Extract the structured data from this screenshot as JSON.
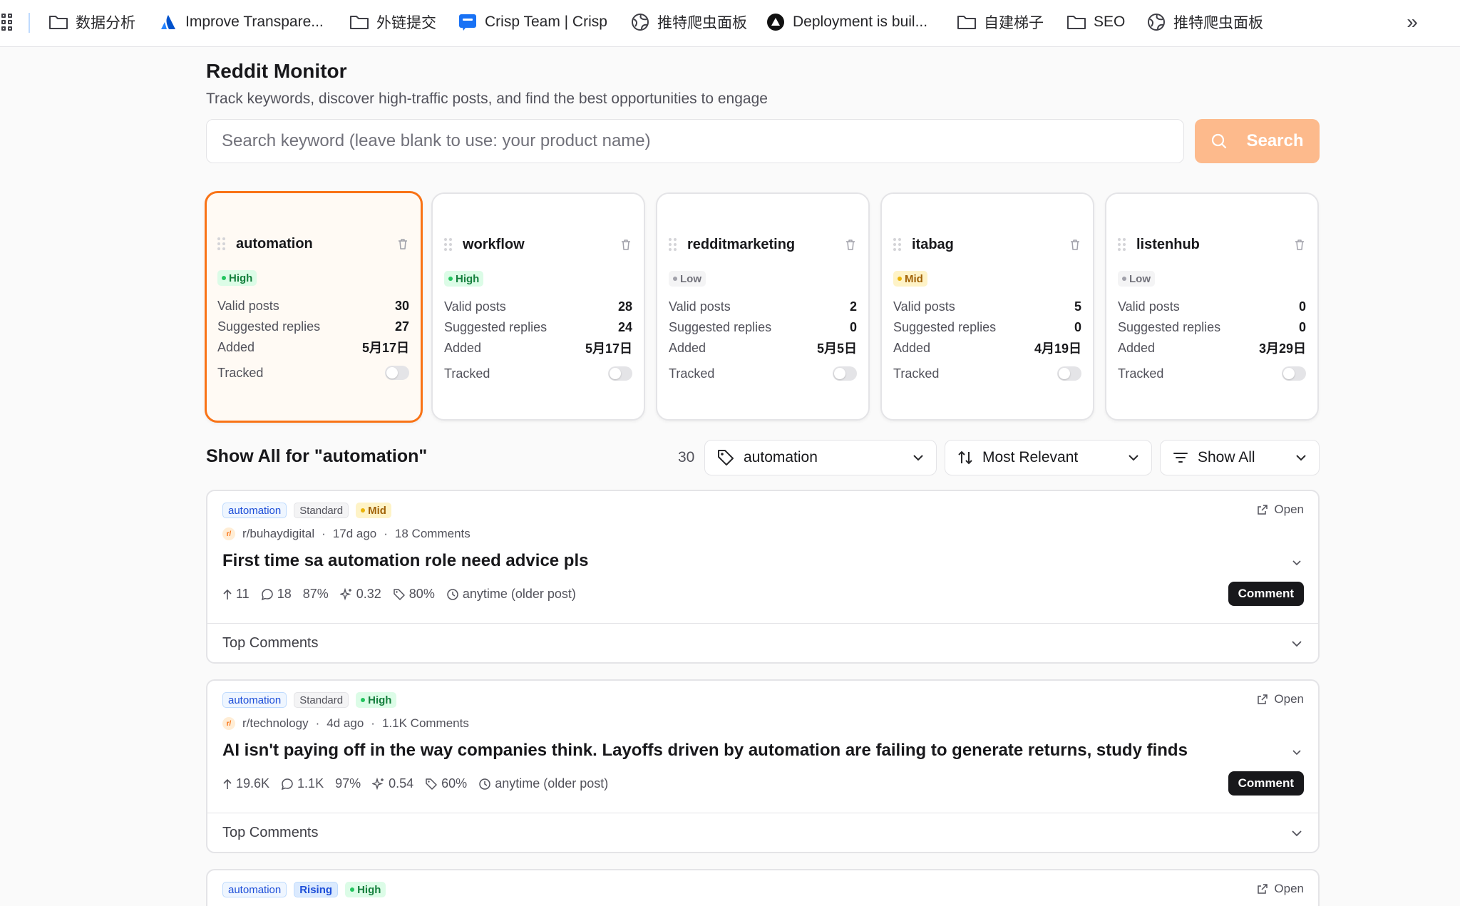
{
  "bookmarks": [
    {
      "label": "数据分析",
      "icon": "folder-icon"
    },
    {
      "label": "Improve Transpare...",
      "icon": "atlassian-icon"
    },
    {
      "label": "外链提交",
      "icon": "folder-icon"
    },
    {
      "label": "Crisp Team | Crisp",
      "icon": "crisp-icon"
    },
    {
      "label": "推特爬虫面板",
      "icon": "globe-icon"
    },
    {
      "label": "Deployment is buil...",
      "icon": "vercel-icon"
    },
    {
      "label": "自建梯子",
      "icon": "folder-icon"
    },
    {
      "label": "SEO",
      "icon": "folder-icon"
    },
    {
      "label": "推特爬虫面板",
      "icon": "globe-icon"
    }
  ],
  "header": {
    "title": "Reddit Monitor",
    "subtitle": "Track keywords, discover high-traffic posts, and find the best opportunities to engage"
  },
  "search": {
    "placeholder": "Search keyword (leave blank to use: your product name)",
    "button_label": "Search"
  },
  "keywords": [
    {
      "name": "automation",
      "level": "High",
      "valid_posts": "30",
      "suggested_replies": "27",
      "added": "5月17日",
      "tracked": false,
      "active": true
    },
    {
      "name": "workflow",
      "level": "High",
      "valid_posts": "28",
      "suggested_replies": "24",
      "added": "5月17日",
      "tracked": false,
      "active": false
    },
    {
      "name": "redditmarketing",
      "level": "Low",
      "valid_posts": "2",
      "suggested_replies": "0",
      "added": "5月5日",
      "tracked": false,
      "active": false
    },
    {
      "name": "itabag",
      "level": "Mid",
      "valid_posts": "5",
      "suggested_replies": "0",
      "added": "4月19日",
      "tracked": false,
      "active": false
    },
    {
      "name": "listenhub",
      "level": "Low",
      "valid_posts": "0",
      "suggested_replies": "0",
      "added": "3月29日",
      "tracked": false,
      "active": false
    }
  ],
  "keyword_labels": {
    "valid_posts": "Valid posts",
    "suggested_replies": "Suggested replies",
    "added": "Added",
    "tracked": "Tracked"
  },
  "results": {
    "title": "Show All for \"automation\"",
    "count": "30",
    "keyword_filter": "automation",
    "sort": "Most Relevant",
    "show": "Show All"
  },
  "posts": [
    {
      "keyword": "automation",
      "type": "Standard",
      "level": "Mid",
      "subreddit": "r/buhaydigital",
      "age": "17d ago",
      "comments": "18 Comments",
      "title": "First time sa automation role need advice pls",
      "upvotes": "11",
      "comment_count": "18",
      "ratio": "87%",
      "score": "0.32",
      "relevance": "80%",
      "time": "anytime (older post)",
      "open_label": "Open",
      "comment_label": "Comment",
      "top_comments_label": "Top Comments"
    },
    {
      "keyword": "automation",
      "type": "Standard",
      "level": "High",
      "subreddit": "r/technology",
      "age": "4d ago",
      "comments": "1.1K Comments",
      "title": "AI isn't paying off in the way companies think. Layoffs driven by automation are failing to generate returns, study finds",
      "upvotes": "19.6K",
      "comment_count": "1.1K",
      "ratio": "97%",
      "score": "0.54",
      "relevance": "60%",
      "time": "anytime (older post)",
      "open_label": "Open",
      "comment_label": "Comment",
      "top_comments_label": "Top Comments"
    },
    {
      "keyword": "automation",
      "type": "Rising",
      "level": "High",
      "open_label": "Open"
    }
  ],
  "colors": {
    "accent": "#f97316",
    "search_button": "#fdba8c",
    "high": "#22c55e",
    "mid": "#eab308",
    "low": "#a1a1aa"
  }
}
